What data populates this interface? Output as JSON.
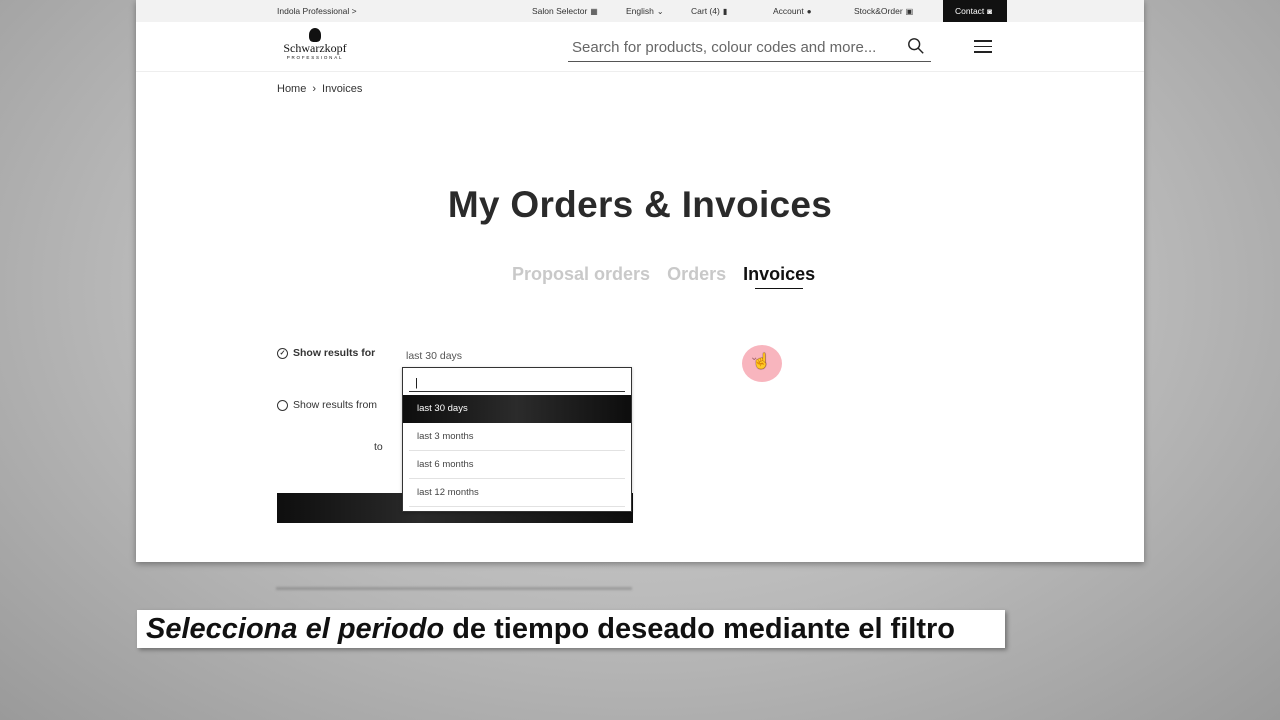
{
  "topbar": {
    "indola": "Indola Professional >",
    "salon_selector": "Salon Selector",
    "language": "English",
    "cart": "Cart (4)",
    "account": "Account",
    "stock_order": "Stock&Order",
    "contact": "Contact"
  },
  "header": {
    "logo_name": "Schwarzkopf",
    "logo_sub": "PROFESSIONAL",
    "search_placeholder": "Search for products, colour codes and more..."
  },
  "breadcrumb": {
    "home": "Home",
    "current": "Invoices"
  },
  "page_title": "My Orders & Invoices",
  "tabs": [
    {
      "label": "Proposal orders",
      "active": false
    },
    {
      "label": "Orders",
      "active": false
    },
    {
      "label": "Invoices",
      "active": true
    }
  ],
  "filters": {
    "show_results_for": "Show results for",
    "show_results_from": "Show results from",
    "to": "to",
    "selected_period": "last 30 days"
  },
  "dropdown": {
    "options": [
      "last 30 days",
      "last 3 months",
      "last 6 months",
      "last 12 months"
    ],
    "selected": "last 30 days"
  },
  "caption": {
    "part1": "Selecciona el periodo",
    "part2": " de tiempo deseado mediante el filtro"
  },
  "icons": [
    "store-icon",
    "chevron-down-icon",
    "bag-icon",
    "user-icon",
    "clipboard-icon",
    "chat-icon",
    "search-icon",
    "menu-icon",
    "check-icon",
    "hand-cursor-icon"
  ]
}
